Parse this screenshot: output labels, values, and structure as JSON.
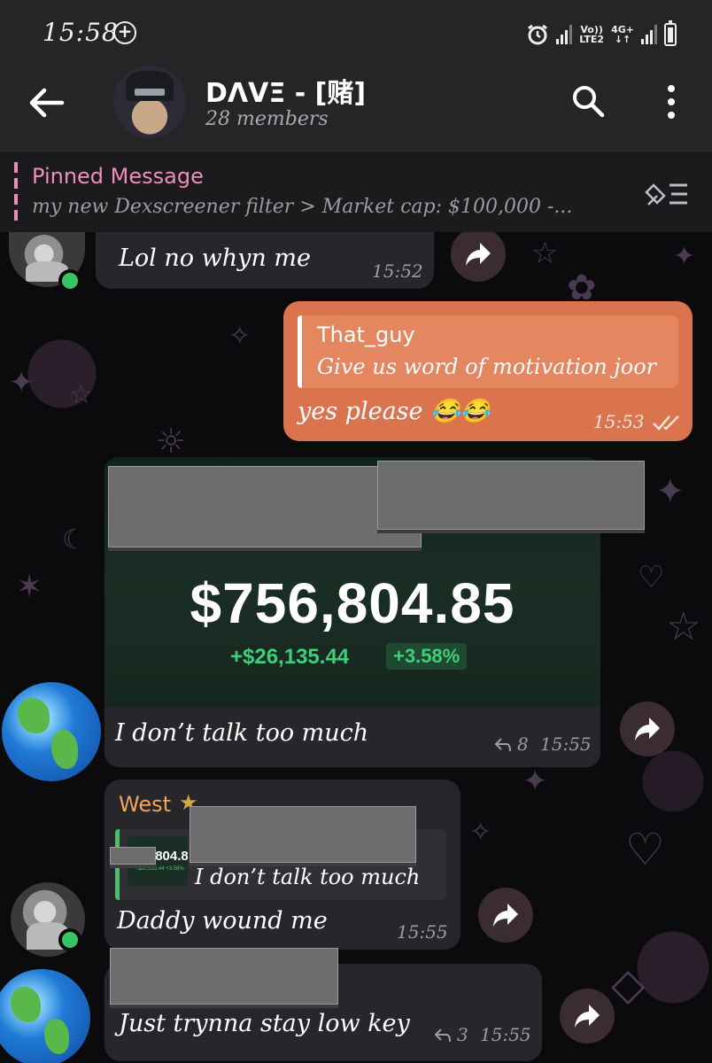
{
  "status_bar": {
    "time": "15:58",
    "network_top": "Vo))",
    "network_bottom": "LTE2",
    "data_top": "4G+",
    "data_bottom": "↓↑"
  },
  "header": {
    "title": "DΛVΞ - [赌]",
    "members": "28 members"
  },
  "pinned": {
    "title": "Pinned Message",
    "text": "my new Dexscreener filter  > Market cap: $100,000 -..."
  },
  "messages": {
    "m1": {
      "text": "Lol no whyn me",
      "time": "15:52"
    },
    "m2": {
      "reply_name": "That_guy",
      "reply_text": "Give us word of motivation joor",
      "text": "yes please 😂😂",
      "time": "15:53"
    },
    "m3": {
      "balance": "$756,804.85",
      "change": "+$26,135.44",
      "percent": "+3.58%",
      "text": "I don’t talk too much",
      "replies": "8",
      "time": "15:55"
    },
    "m4": {
      "sender": "West",
      "quote_thumb_big": "756,804.8",
      "quote_thumb_small": "+$26,135.44  +3.58%",
      "quote_text": "I don’t talk too much",
      "text": "Daddy wound me",
      "time": "15:55"
    },
    "m5": {
      "text": "Just trynna stay low key",
      "replies": "3",
      "time": "15:55"
    }
  },
  "colors": {
    "accent_pink": "#ef8fb8",
    "outgoing_bubble": "#d9744f",
    "incoming_bubble": "#27262b",
    "gain_green": "#3ecf7a",
    "sender_orange": "#f0a45c"
  }
}
